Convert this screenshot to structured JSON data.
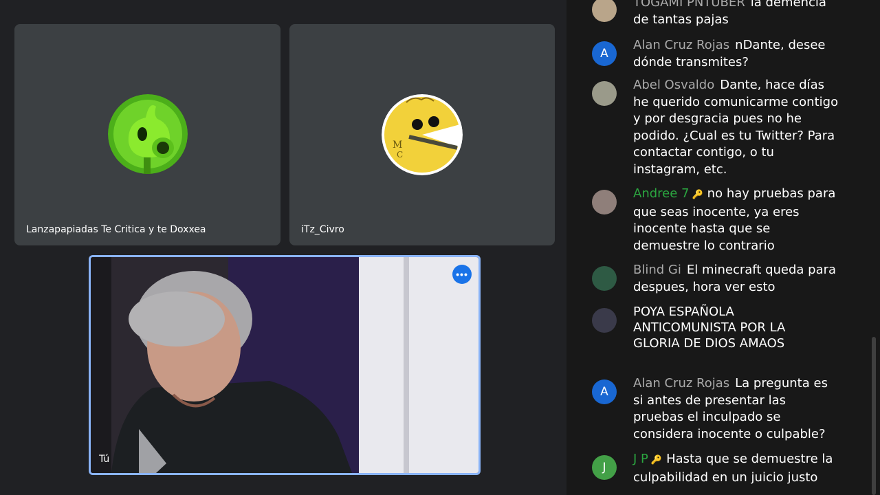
{
  "tiles": [
    {
      "name": "Lanzapapiadas Te Critica y te Doxxea",
      "avatar": "peashooter-avatar"
    },
    {
      "name": "iTz_Civro",
      "avatar": "pacman-avatar"
    }
  ],
  "self_tile": {
    "name": "Tú",
    "more_icon": "more-options-icon",
    "more_symbol": "•••"
  },
  "chat": {
    "messages": [
      {
        "author": "TOGAMI PNTUBER",
        "text": "la demencia de tantas pajas",
        "avatar_type": "image",
        "avatar_color": "#b9a58a"
      },
      {
        "author": "Alan Cruz Rojas",
        "text": "nDante, desee dónde transmites?",
        "avatar_type": "letter",
        "avatar_letter": "A",
        "avatar_color": "#1967d2"
      },
      {
        "author": "Abel Osvaldo",
        "text": "Dante, hace días he querido comunicarme contigo y por desgracia pues no he podido. ¿Cual es tu Twitter? Para contactar contigo, o tu instagram, etc.",
        "avatar_type": "image",
        "avatar_color": "#9a9a8a"
      },
      {
        "author": "Andree 7",
        "text": "no hay pruebas para que seas inocente, ya eres inocente hasta que se demuestre lo contrario",
        "avatar_type": "image",
        "avatar_color": "#8f7f7a",
        "member": true,
        "badge": "🔑"
      },
      {
        "author": "Blind Gi",
        "text": "El minecraft queda para despues, hora ver esto",
        "avatar_type": "image",
        "avatar_color": "#2e5a44"
      },
      {
        "author": "",
        "text": "POYA ESPAÑOLA ANTICOMUNISTA POR LA GLORIA DE DIOS AMAOS",
        "avatar_type": "image",
        "avatar_color": "#3a3a4a",
        "highlight": "POYA ESPAÑOLA ANTICOMUNISTA POR LA GLORIA DE DIOS"
      },
      {
        "author": "Alan Cruz Rojas",
        "text": "La pregunta es si antes de presentar las pruebas el inculpado se considera inocente o culpable?",
        "avatar_type": "letter",
        "avatar_letter": "A",
        "avatar_color": "#1967d2"
      },
      {
        "author": "J P",
        "text": "Hasta que se demuestre la culpabilidad en un juicio justo",
        "avatar_type": "letter",
        "avatar_letter": "J",
        "avatar_color": "#43a047",
        "member": true,
        "badge": "🔑"
      }
    ]
  }
}
